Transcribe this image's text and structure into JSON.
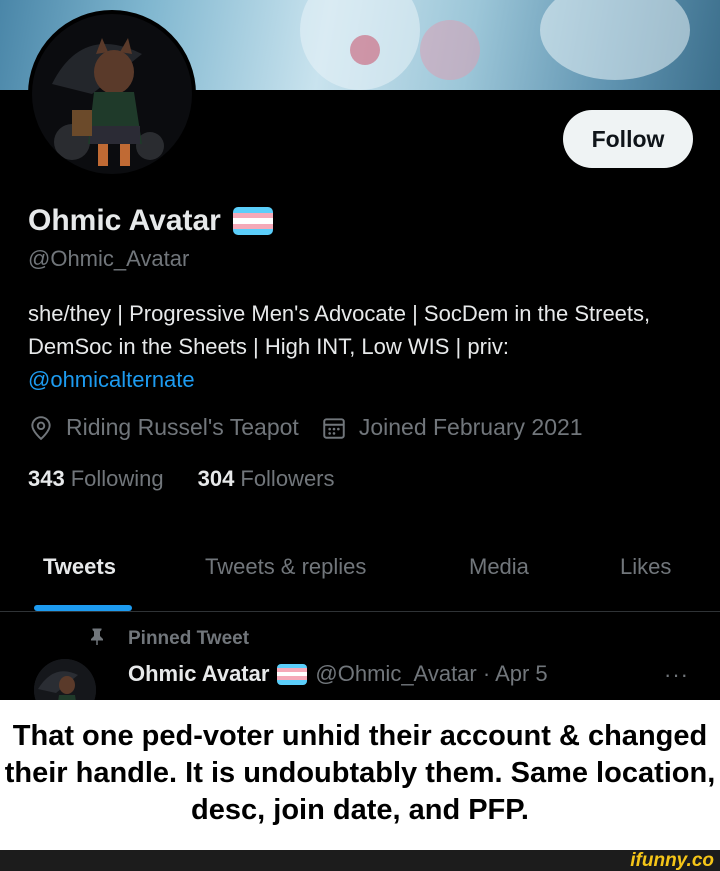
{
  "profile": {
    "display_name": "Ohmic Avatar",
    "handle": "@Ohmic_Avatar",
    "follow_label": "Follow",
    "bio_text": "she/they | Progressive Men's Advocate | SocDem in the Streets, DemSoc in the Sheets | High INT, Low WIS | priv:",
    "bio_mention": "@ohmicalternate",
    "location": "Riding Russel's Teapot",
    "joined": "Joined February 2021",
    "following_count": "343",
    "following_label": "Following",
    "followers_count": "304",
    "followers_label": "Followers",
    "flag_colors": [
      "#5bcefa",
      "#f5a9b8",
      "#ffffff",
      "#f5a9b8",
      "#5bcefa"
    ]
  },
  "tabs": [
    {
      "label": "Tweets",
      "active": true
    },
    {
      "label": "Tweets & replies",
      "active": false
    },
    {
      "label": "Media",
      "active": false
    },
    {
      "label": "Likes",
      "active": false
    }
  ],
  "pinned_tweet": {
    "pinned_label": "Pinned Tweet",
    "author_name": "Ohmic Avatar",
    "author_handle_date": "@Ohmic_Avatar · Apr 5",
    "more_label": "···"
  },
  "caption": {
    "text": "That one ped-voter unhid their account & changed their handle. It is undoubtably them. Same location, desc, join date, and PFP."
  },
  "watermark": "ifunny.co",
  "colors": {
    "accent": "#1d9bf0",
    "muted": "#71767b",
    "background": "#000000"
  }
}
